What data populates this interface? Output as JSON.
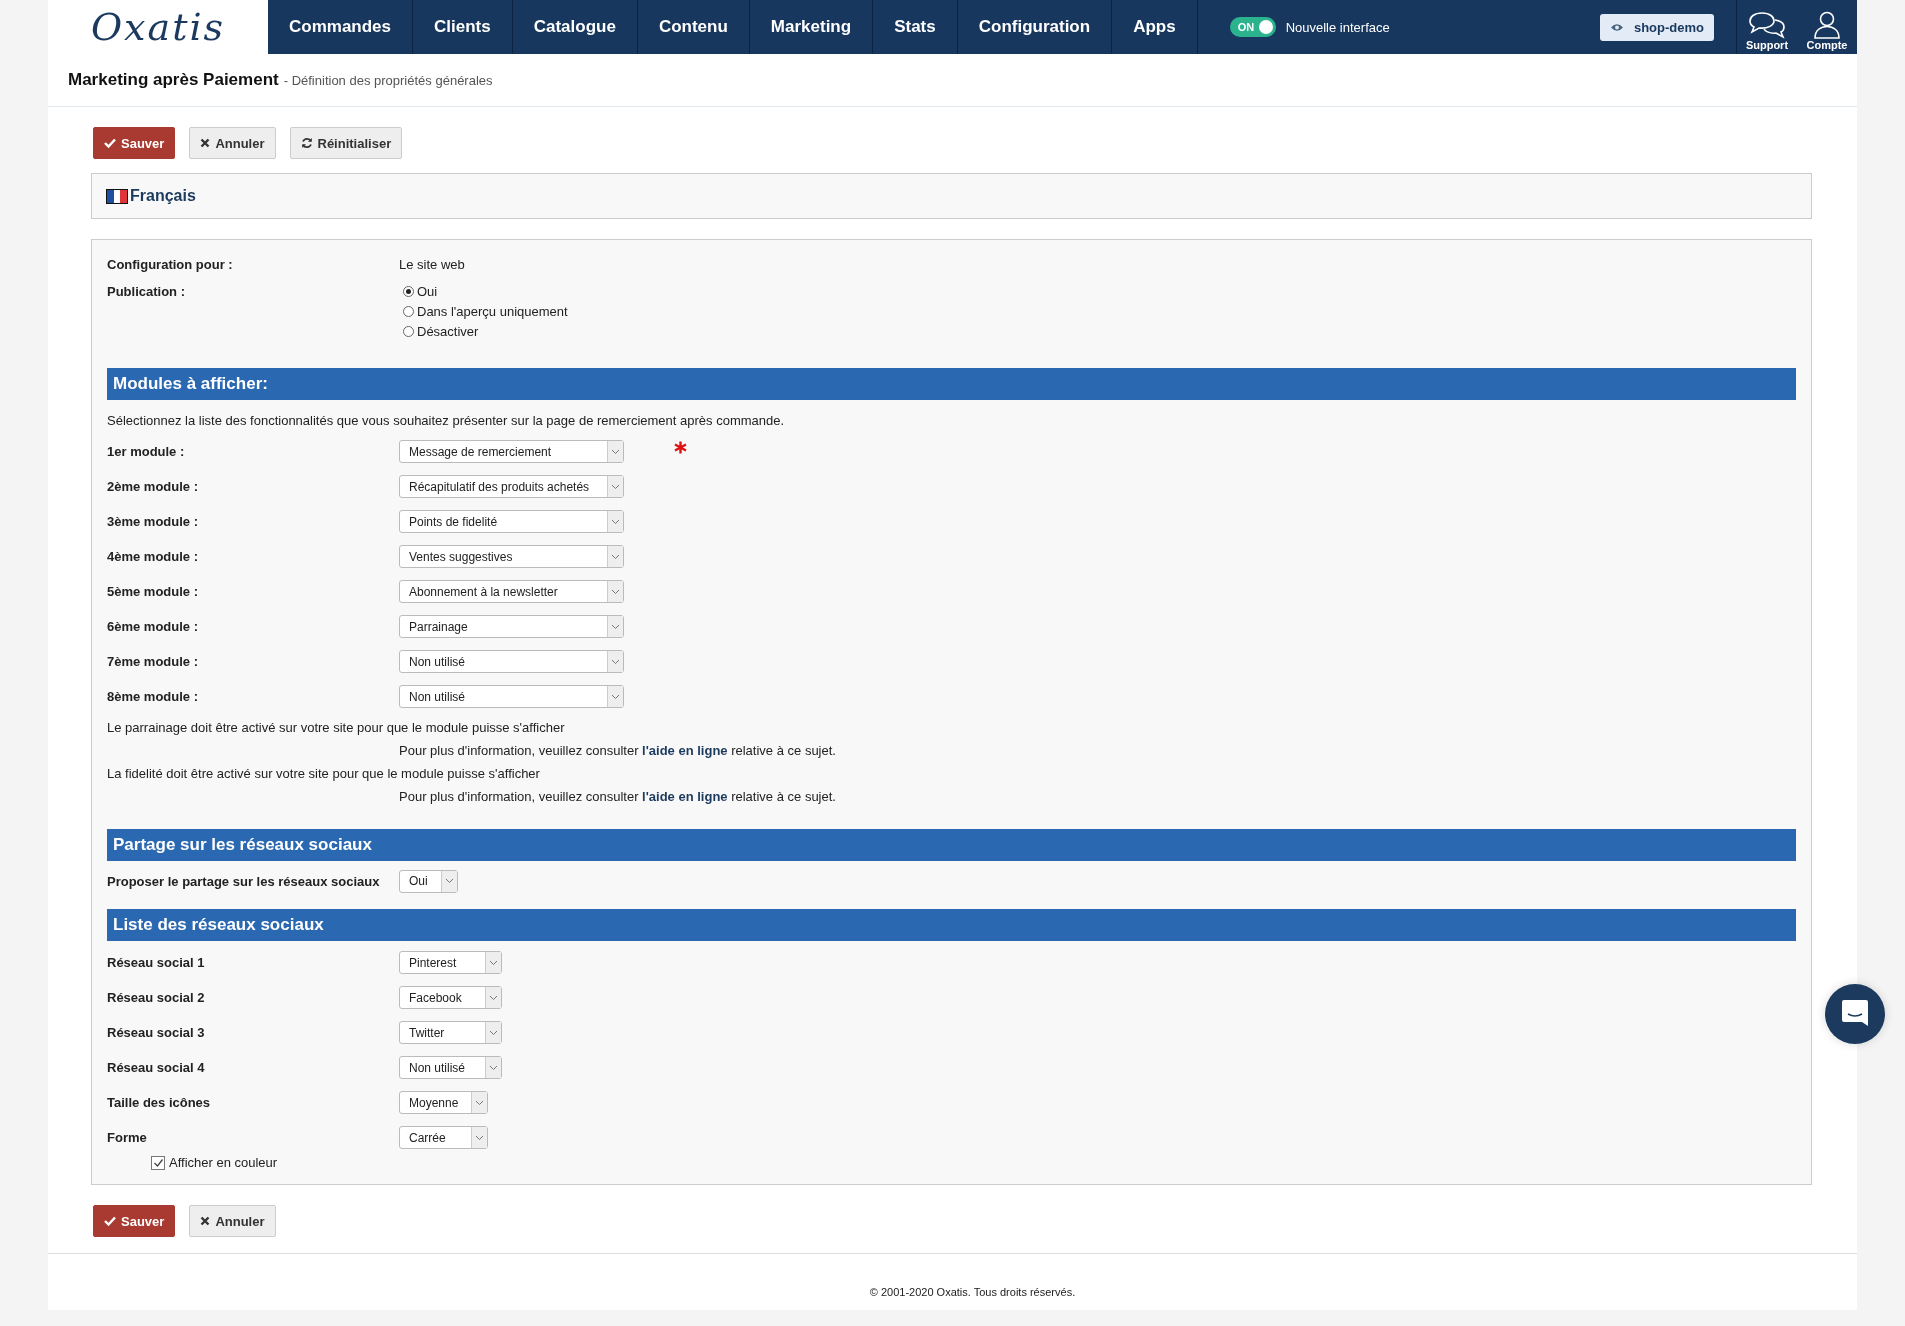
{
  "logo": "Oxatis",
  "nav": [
    "Commandes",
    "Clients",
    "Catalogue",
    "Contenu",
    "Marketing",
    "Stats",
    "Configuration",
    "Apps"
  ],
  "interface_toggle": {
    "label": "ON",
    "on": true,
    "text": "Nouvelle interface"
  },
  "shop_button": "shop-demo",
  "top_actions": [
    {
      "kind": "support",
      "label": "Support"
    },
    {
      "kind": "account",
      "label": "Compte"
    }
  ],
  "page_title": {
    "title": "Marketing après Paiement",
    "subtitle": "- Définition des propriétés générales"
  },
  "toolbar": [
    {
      "kind": "save",
      "label": "Sauver"
    },
    {
      "kind": "cancel",
      "label": "Annuler"
    },
    {
      "kind": "reset",
      "label": "Réinitialiser"
    }
  ],
  "language": "Français",
  "config": {
    "label": "Configuration pour :",
    "value": "Le site web"
  },
  "publication": {
    "label": "Publication :",
    "options": [
      {
        "label": "Oui",
        "selected": true
      },
      {
        "label": "Dans l'aperçu uniquement",
        "selected": false
      },
      {
        "label": "Désactiver",
        "selected": false
      }
    ]
  },
  "modules_section": {
    "title": "Modules à afficher:",
    "intro": "Sélectionnez la liste des fonctionnalités que vous souhaitez présenter sur la page de remerciement après commande.",
    "modules": [
      {
        "label": "1er module :",
        "value": "Message de remerciement",
        "required": true
      },
      {
        "label": "2ème module :",
        "value": "Récapitulatif des produits achetés",
        "required": false
      },
      {
        "label": "3ème module :",
        "value": "Points de fidelité",
        "required": false
      },
      {
        "label": "4ème module :",
        "value": "Ventes suggestives",
        "required": false
      },
      {
        "label": "5ème module :",
        "value": "Abonnement à la newsletter",
        "required": false
      },
      {
        "label": "6ème module :",
        "value": "Parrainage",
        "required": false
      },
      {
        "label": "7ème module :",
        "value": "Non utilisé",
        "required": false
      },
      {
        "label": "8ème module :",
        "value": "Non utilisé",
        "required": false
      }
    ],
    "notes": [
      {
        "warning": "Le parrainage doit être activé sur votre site pour que le module puisse s'afficher",
        "before": "Pour plus d'information, veuillez consulter ",
        "link": "l'aide en ligne",
        "after": " relative à ce sujet."
      },
      {
        "warning": "La fidelité doit être activé sur votre site pour que le module puisse s'afficher",
        "before": "Pour plus d'information, veuillez consulter ",
        "link": "l'aide en ligne",
        "after": " relative à ce sujet."
      }
    ]
  },
  "sharing_section": {
    "title": "Partage sur les réseaux sociaux",
    "label": "Proposer le partage sur les réseaux sociaux",
    "value": "Oui"
  },
  "networks_section": {
    "title": "Liste des réseaux sociaux",
    "fields": [
      {
        "label": "Réseau social 1",
        "value": "Pinterest"
      },
      {
        "label": "Réseau social 2",
        "value": "Facebook"
      },
      {
        "label": "Réseau social 3",
        "value": "Twitter"
      },
      {
        "label": "Réseau social 4",
        "value": "Non utilisé"
      },
      {
        "label": "Taille des icônes",
        "value": "Moyenne"
      },
      {
        "label": "Forme",
        "value": "Carrée"
      }
    ],
    "color_option": {
      "label": "Afficher en couleur",
      "checked": true
    }
  },
  "bottom_toolbar": [
    {
      "kind": "save",
      "label": "Sauver"
    },
    {
      "kind": "cancel",
      "label": "Annuler"
    }
  ],
  "footer": "© 2001-2020 Oxatis. Tous droits réservés."
}
